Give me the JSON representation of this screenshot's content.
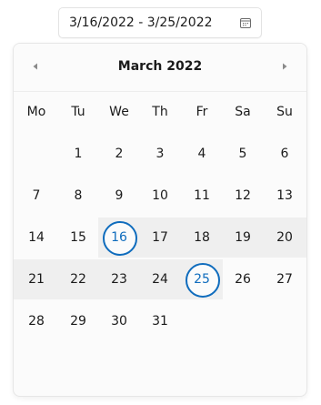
{
  "date_range_input": {
    "value": "3/16/2022 - 3/25/2022",
    "icon": "calendar-icon"
  },
  "calendar": {
    "month_title": "March 2022",
    "prev_icon": "triangle-left-icon",
    "next_icon": "triangle-right-icon",
    "weekdays": [
      "Mo",
      "Tu",
      "We",
      "Th",
      "Fr",
      "Sa",
      "Su"
    ],
    "weeks": [
      [
        "",
        "1",
        "2",
        "3",
        "4",
        "5",
        "6"
      ],
      [
        "7",
        "8",
        "9",
        "10",
        "11",
        "12",
        "13"
      ],
      [
        "14",
        "15",
        "16",
        "17",
        "18",
        "19",
        "20"
      ],
      [
        "21",
        "22",
        "23",
        "24",
        "25",
        "26",
        "27"
      ],
      [
        "28",
        "29",
        "30",
        "31",
        "",
        "",
        ""
      ]
    ],
    "range_start": "16",
    "range_end": "25",
    "accent_color": "#0f6cbd",
    "range_fill_color": "#efefef"
  }
}
